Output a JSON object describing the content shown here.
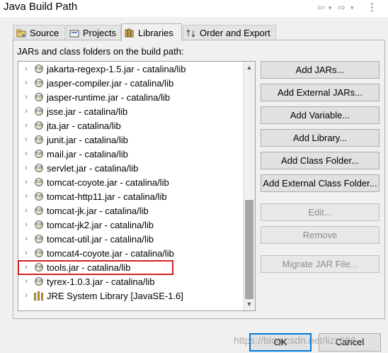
{
  "window": {
    "title": "Java Build Path"
  },
  "nav": {
    "back_icon": "back-arrow-icon",
    "forward_icon": "forward-arrow-icon",
    "menu_icon": "view-menu-icon"
  },
  "tabs": [
    {
      "label": "Source",
      "icon": "source-folder-icon"
    },
    {
      "label": "Projects",
      "icon": "projects-icon"
    },
    {
      "label": "Libraries",
      "icon": "libraries-icon",
      "active": true
    },
    {
      "label": "Order and Export",
      "icon": "order-export-icon"
    }
  ],
  "panel": {
    "label": "JARs and class folders on the build path:"
  },
  "tree": {
    "items": [
      {
        "label": "jakarta-regexp-1.5.jar - catalina/lib",
        "type": "jar"
      },
      {
        "label": "jasper-compiler.jar - catalina/lib",
        "type": "jar"
      },
      {
        "label": "jasper-runtime.jar - catalina/lib",
        "type": "jar"
      },
      {
        "label": "jsse.jar - catalina/lib",
        "type": "jar"
      },
      {
        "label": "jta.jar - catalina/lib",
        "type": "jar"
      },
      {
        "label": "junit.jar - catalina/lib",
        "type": "jar"
      },
      {
        "label": "mail.jar - catalina/lib",
        "type": "jar"
      },
      {
        "label": "servlet.jar - catalina/lib",
        "type": "jar"
      },
      {
        "label": "tomcat-coyote.jar - catalina/lib",
        "type": "jar"
      },
      {
        "label": "tomcat-http11.jar - catalina/lib",
        "type": "jar"
      },
      {
        "label": "tomcat-jk.jar - catalina/lib",
        "type": "jar"
      },
      {
        "label": "tomcat-jk2.jar - catalina/lib",
        "type": "jar"
      },
      {
        "label": "tomcat-util.jar - catalina/lib",
        "type": "jar"
      },
      {
        "label": "tomcat4-coyote.jar - catalina/lib",
        "type": "jar"
      },
      {
        "label": "tools.jar - catalina/lib",
        "type": "jar",
        "highlighted": true
      },
      {
        "label": "tyrex-1.0.3.jar - catalina/lib",
        "type": "jar"
      },
      {
        "label": "JRE System Library [JavaSE-1.6]",
        "type": "library"
      }
    ],
    "jar_glyph": "010"
  },
  "buttons": {
    "add_jars": "Add JARs...",
    "add_external_jars": "Add External JARs...",
    "add_variable": "Add Variable...",
    "add_library": "Add Library...",
    "add_class_folder": "Add Class Folder...",
    "add_external_class_folder": "Add External Class Folder...",
    "edit": "Edit...",
    "remove": "Remove",
    "migrate_jar": "Migrate JAR File..."
  },
  "footer": {
    "ok": "OK",
    "cancel": "Cancel",
    "watermark": "https://blog.csdn.net/lizz666"
  },
  "colors": {
    "highlight_border": "#d42020",
    "ok_border": "#0078d7"
  }
}
